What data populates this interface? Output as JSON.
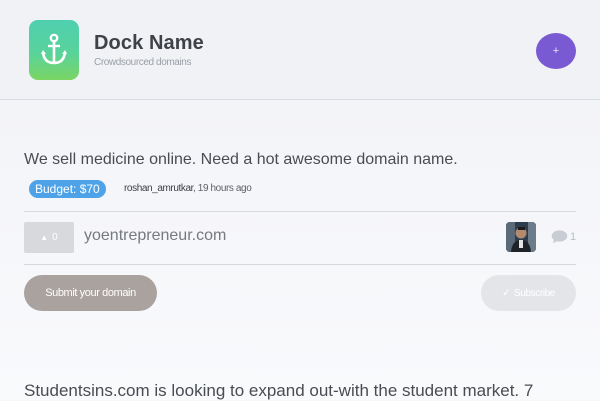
{
  "header": {
    "title": "Dock Name",
    "subtitle": "Crowdsourced domains",
    "add_button_label": "+",
    "logo_icon": "anchor-icon",
    "logo_colors": [
      "#4ecfb0",
      "#7ad563"
    ],
    "accent_color": "#7a5ad3"
  },
  "request": {
    "title": "We sell medicine online. Need a hot awesome domain name.",
    "budget": "Budget: $70",
    "author": "roshan_amrutkar",
    "time": ", 19 hours ago",
    "budget_color": "#4ea3e8",
    "suggestions": [
      {
        "votes_icon": "▲",
        "votes": "0",
        "domain": "yoentrepreneur.com",
        "comment_icon": "comment-icon",
        "comments": "1"
      }
    ],
    "submit_label": "Submit your domain",
    "subscribe_icon": "✓",
    "subscribe_label": "Subscribe"
  },
  "next_request": {
    "title": "Studentsins.com is looking to expand out-with the student market. 7"
  }
}
